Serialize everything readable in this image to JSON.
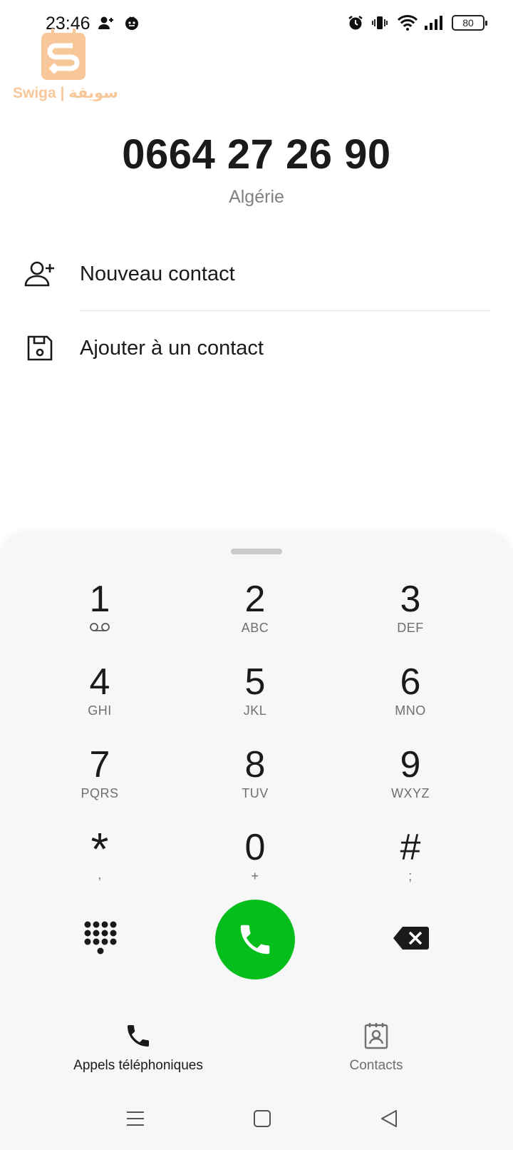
{
  "status_bar": {
    "time": "23:46",
    "battery": "80",
    "icons": [
      "person-add-icon",
      "face-icon",
      "alarm-icon",
      "vibrate-icon",
      "wifi-icon",
      "signal-icon",
      "battery-icon"
    ]
  },
  "watermark": {
    "text": "Swiga | سويقة",
    "color": "#f8c79a"
  },
  "dialed": {
    "number": "0664 27 26 90",
    "region": "Algérie"
  },
  "actions": [
    {
      "label": "Nouveau contact",
      "icon": "person-add-icon"
    },
    {
      "label": "Ajouter à un contact",
      "icon": "save-icon"
    }
  ],
  "keypad": [
    {
      "digit": "1",
      "letters": ""
    },
    {
      "digit": "2",
      "letters": "ABC"
    },
    {
      "digit": "3",
      "letters": "DEF"
    },
    {
      "digit": "4",
      "letters": "GHI"
    },
    {
      "digit": "5",
      "letters": "JKL"
    },
    {
      "digit": "6",
      "letters": "MNO"
    },
    {
      "digit": "7",
      "letters": "PQRS"
    },
    {
      "digit": "8",
      "letters": "TUV"
    },
    {
      "digit": "9",
      "letters": "WXYZ"
    },
    {
      "digit": "*",
      "letters": ","
    },
    {
      "digit": "0",
      "letters": "+"
    },
    {
      "digit": "#",
      "letters": ";"
    }
  ],
  "colors": {
    "call_button": "#05be1c",
    "accent_text": "#1a1a1a",
    "muted_text": "#808080"
  },
  "bottom_nav": {
    "calls": {
      "label": "Appels téléphoniques",
      "icon": "phone-icon",
      "active": true
    },
    "contacts": {
      "label": "Contacts",
      "icon": "contacts-book-icon",
      "active": false
    }
  },
  "system_nav": [
    "menu-icon",
    "home-icon",
    "back-icon"
  ]
}
